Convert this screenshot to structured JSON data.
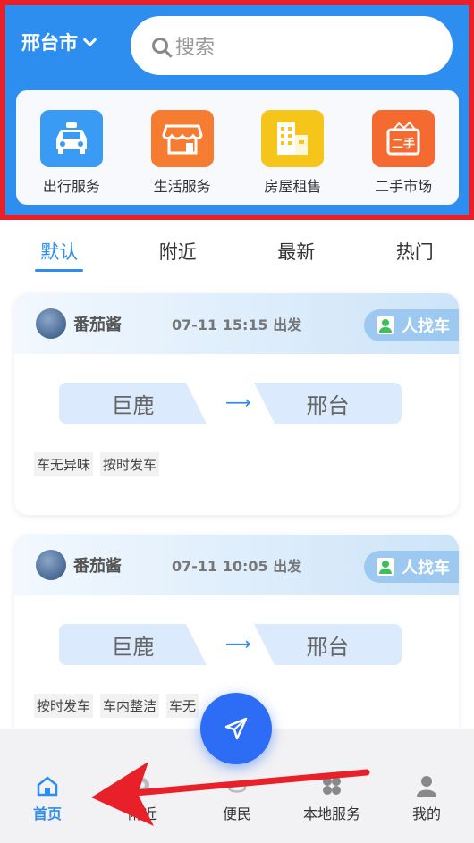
{
  "header": {
    "city": "邢台市",
    "search_placeholder": "搜索"
  },
  "services": [
    {
      "label": "出行服务",
      "icon": "taxi-icon",
      "color": "#3a9bf5"
    },
    {
      "label": "生活服务",
      "icon": "shop-icon",
      "color": "#f57c30"
    },
    {
      "label": "房屋租售",
      "icon": "building-icon",
      "color": "#f5c519"
    },
    {
      "label": "二手市场",
      "icon": "secondhand-box-icon",
      "color": "#f56a30"
    }
  ],
  "tabs": [
    "默认",
    "附近",
    "最新",
    "热门"
  ],
  "active_tab": "默认",
  "posts": [
    {
      "user": "番茄酱",
      "time": "07-11 15:15 出发",
      "badge": "人找车",
      "from": "巨鹿",
      "to": "邢台",
      "tags": [
        "车无异味",
        "按时发车"
      ]
    },
    {
      "user": "番茄酱",
      "time": "07-11 10:05 出发",
      "badge": "人找车",
      "from": "巨鹿",
      "to": "邢台",
      "tags": [
        "按时发车",
        "车内整洁",
        "车无"
      ]
    }
  ],
  "bottom_nav": [
    {
      "label": "首页",
      "icon": "home-icon",
      "active": true
    },
    {
      "label": "附近",
      "icon": "nearby-icon",
      "active": false
    },
    {
      "label": "便民",
      "icon": "convenience-icon",
      "active": false
    },
    {
      "label": "本地服务",
      "icon": "grid-icon",
      "active": false
    },
    {
      "label": "我的",
      "icon": "profile-icon",
      "active": false
    }
  ],
  "colors": {
    "primary": "#2d8ef0",
    "highlight_border": "#e8202a",
    "fab": "#2d6cf5"
  }
}
